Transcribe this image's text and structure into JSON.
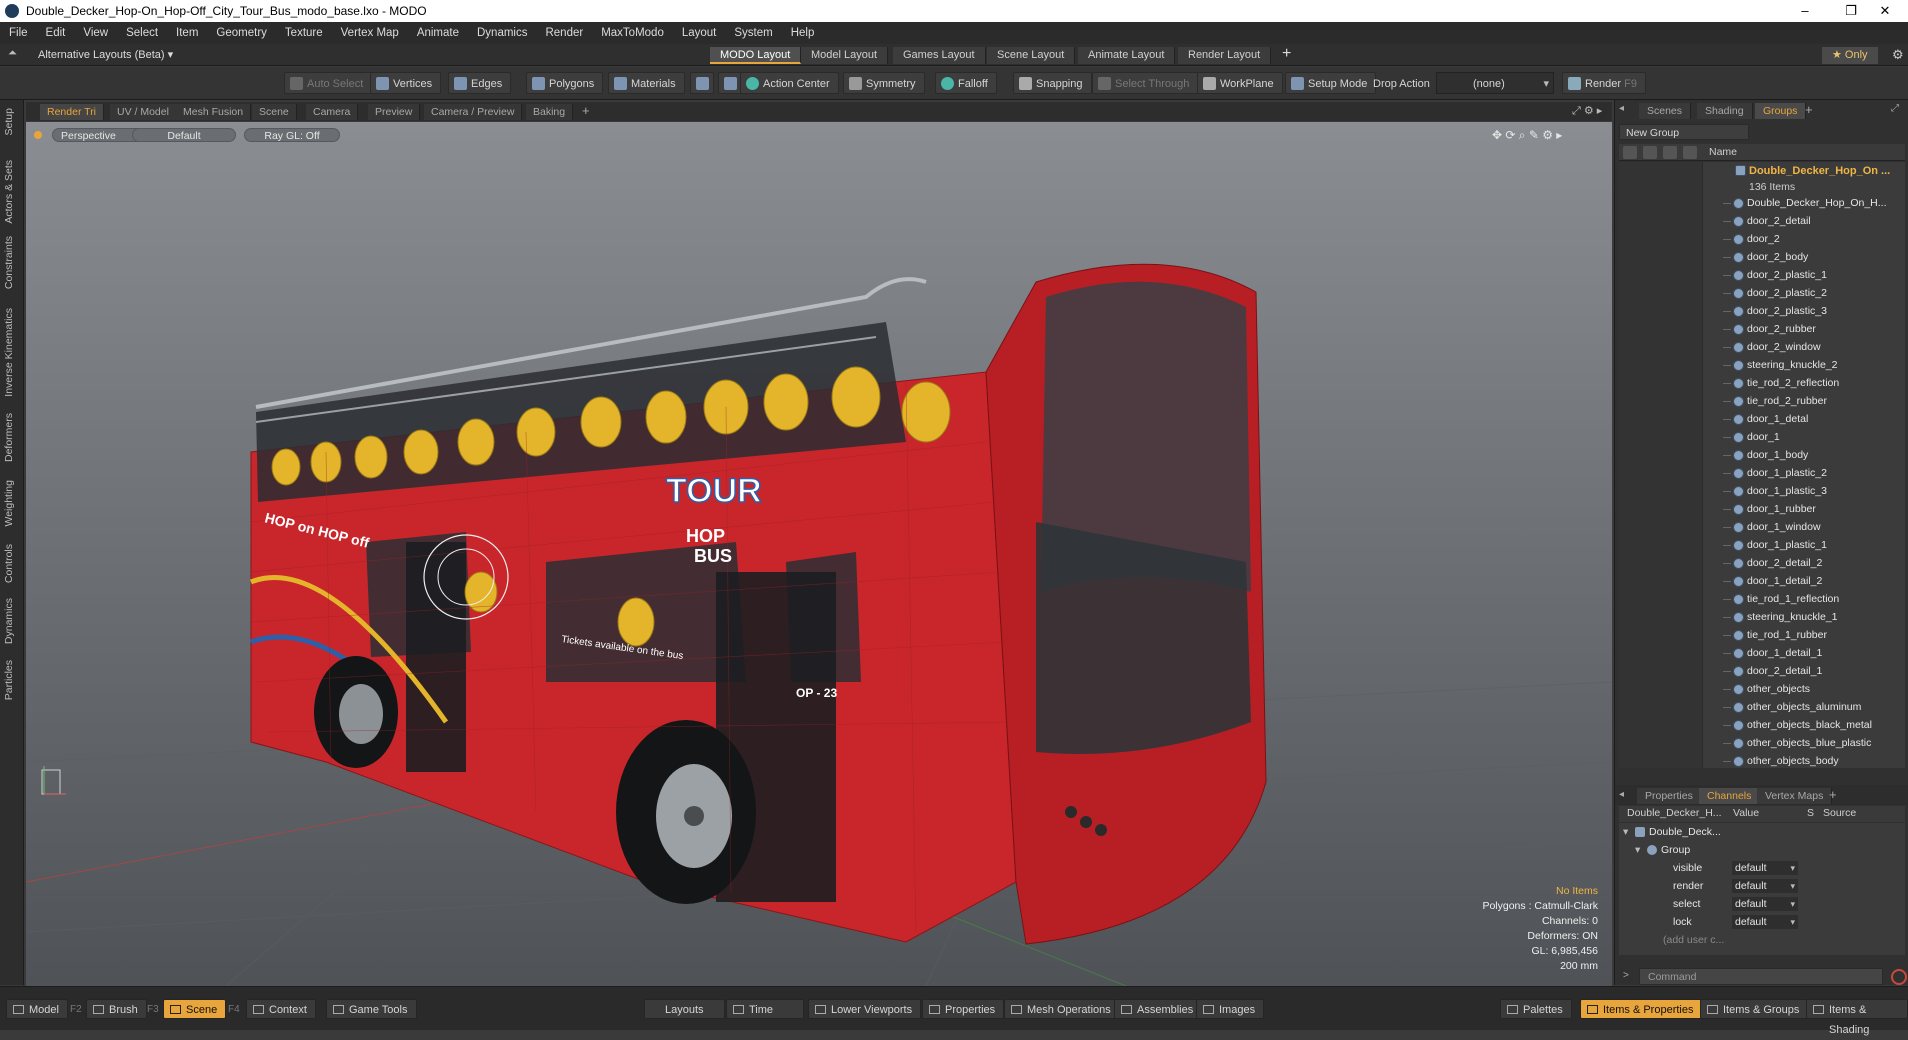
{
  "window": {
    "title": "Double_Decker_Hop-On_Hop-Off_City_Tour_Bus_modo_base.lxo - MODO",
    "minimize": "–",
    "restore": "❐",
    "close": "✕"
  },
  "menu": [
    "File",
    "Edit",
    "View",
    "Select",
    "Item",
    "Geometry",
    "Texture",
    "Vertex Map",
    "Animate",
    "Dynamics",
    "Render",
    "MaxToModo",
    "Layout",
    "System",
    "Help"
  ],
  "layoutbar": {
    "alt_layouts": "Alternative Layouts (Beta) ▾",
    "tabs": [
      "MODO Layout",
      "Model Layout",
      "Games Layout",
      "Scene Layout",
      "Animate Layout",
      "Render Layout"
    ],
    "active_tab": "MODO Layout",
    "add": "+",
    "only": "★  Only"
  },
  "toolbar": {
    "auto_select": "Auto Select",
    "vertices": "Vertices",
    "edges": "Edges",
    "polygons": "Polygons",
    "materials": "Materials",
    "action_center": "Action Center",
    "symmetry": "Symmetry",
    "falloff": "Falloff",
    "snapping": "Snapping",
    "select_through": "Select Through",
    "workplane": "WorkPlane",
    "setup_mode": "Setup Mode",
    "drop_action": "Drop Action",
    "drop_value": "(none)",
    "render": "Render",
    "render_key": "F9"
  },
  "left_tabs": [
    "Setup",
    "Actors & Sets",
    "Constraints",
    "Inverse Kinematics",
    "Deformers",
    "Weighting",
    "Controls",
    "Dynamics",
    "Particles"
  ],
  "viewport_tabs": [
    "Render Tri",
    "UV / Model",
    "Mesh Fusion",
    "Scene",
    "Camera",
    "Preview",
    "Camera / Preview",
    "Baking"
  ],
  "viewport": {
    "perspective": "Perspective",
    "shading": "Default",
    "raygl": "Ray GL: Off",
    "bus_text_tour": "TOUR",
    "bus_text_hop": "HOP",
    "bus_text_bus": "BUS",
    "bus_side_slogan": "HOP on HOP off",
    "bus_tickets": "Tickets available on the bus",
    "bus_route": "OP - 23",
    "info": {
      "items": "No Items",
      "polygons": "Polygons : Catmull-Clark",
      "channels": "Channels: 0",
      "deformers": "Deformers: ON",
      "gl": "GL: 6,985,456",
      "scale": "200 mm"
    },
    "colors": {
      "bus_red": "#c8262b",
      "seat_yellow": "#e4b52a",
      "selection_orange": "#e8a53c"
    }
  },
  "right_panel": {
    "tabs": [
      "Scenes",
      "Shading",
      "Groups"
    ],
    "active_tab": "Groups",
    "new_group": "New Group",
    "name_col": "Name",
    "root": {
      "label": "Double_Decker_Hop_On ...",
      "count": "136 Items"
    },
    "items": [
      "Double_Decker_Hop_On_H...",
      "door_2_detail",
      "door_2",
      "door_2_body",
      "door_2_plastic_1",
      "door_2_plastic_2",
      "door_2_plastic_3",
      "door_2_rubber",
      "door_2_window",
      "steering_knuckle_2",
      "tie_rod_2_reflection",
      "tie_rod_2_rubber",
      "door_1_detal",
      "door_1",
      "door_1_body",
      "door_1_plastic_2",
      "door_1_plastic_3",
      "door_1_rubber",
      "door_1_window",
      "door_1_plastic_1",
      "door_2_detail_2",
      "door_1_detail_2",
      "tie_rod_1_reflection",
      "steering_knuckle_1",
      "tie_rod_1_rubber",
      "door_1_detail_1",
      "door_2_detail_1",
      "other_objects",
      "other_objects_aluminum",
      "other_objects_black_metal",
      "other_objects_blue_plastic",
      "other_objects_body"
    ]
  },
  "channels_panel": {
    "tabs": [
      "Properties",
      "Channels",
      "Vertex Maps"
    ],
    "active_tab": "Channels",
    "head_name": "Double_Decker_H...",
    "head_value": "Value",
    "head_s": "S",
    "head_source": "Source",
    "root": "Double_Deck...",
    "group": "Group",
    "rows": [
      {
        "name": "visible",
        "value": "default"
      },
      {
        "name": "render",
        "value": "default"
      },
      {
        "name": "select",
        "value": "default"
      },
      {
        "name": "lock",
        "value": "default"
      }
    ],
    "add_user": "(add user c...",
    "command": "Command"
  },
  "bottombar": {
    "model": "Model",
    "model_key": "F2",
    "brush": "Brush",
    "brush_key": "F3",
    "scene": "Scene",
    "scene_key": "F4",
    "context": "Context",
    "game_tools": "Game Tools",
    "layouts": "Layouts",
    "time": "Time",
    "lower_viewports": "Lower Viewports",
    "properties": "Properties",
    "mesh_operations": "Mesh Operations",
    "assemblies": "Assemblies",
    "images": "Images",
    "palettes": "Palettes",
    "items_properties": "Items & Properties",
    "items_groups": "Items & Groups",
    "items_shading": "Items & Shading"
  }
}
